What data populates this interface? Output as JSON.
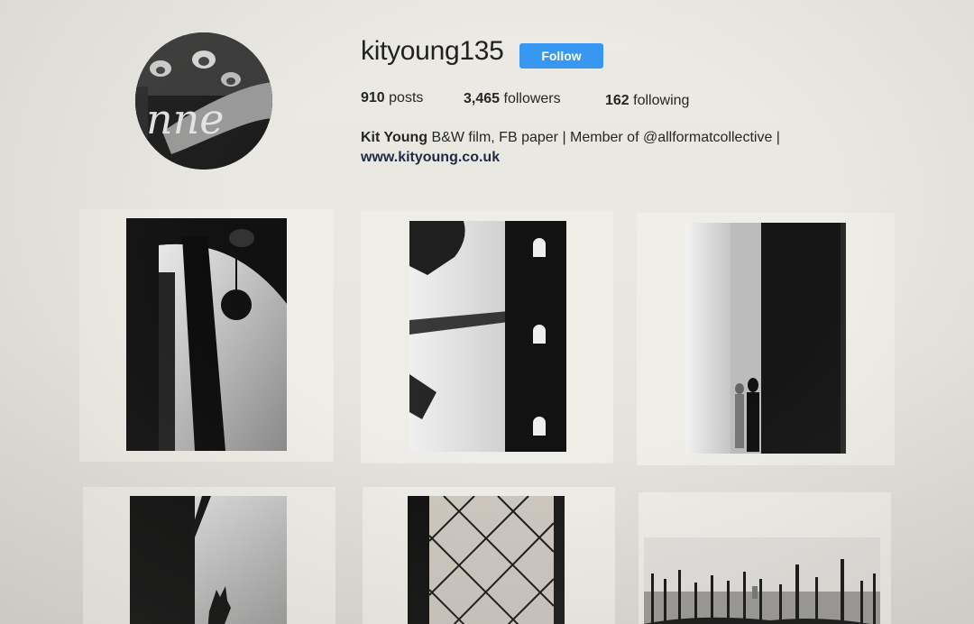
{
  "profile": {
    "username": "kityoung135",
    "follow_label": "Follow",
    "posts_count": "910",
    "posts_label": "posts",
    "followers_count": "3,465",
    "followers_label": "followers",
    "following_count": "162",
    "following_label": "following",
    "full_name": "Kit Young",
    "bio": "B&W film, FB paper | Member of @allformatcollective |",
    "website": "www.kityoung.co.uk"
  },
  "colors": {
    "follow_button": "#3897f0",
    "background": "#e9e7e1"
  },
  "grid": {
    "posts": [
      {
        "subject": "lamp-silhouette-photo"
      },
      {
        "subject": "tower-windows-photo"
      },
      {
        "subject": "column-figure-photo"
      },
      {
        "subject": "gondolier-silhouette-photo"
      },
      {
        "subject": "lattice-window-photo"
      },
      {
        "subject": "gondolas-harbor-photo"
      }
    ]
  }
}
